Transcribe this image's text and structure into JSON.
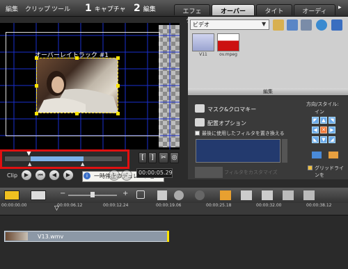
{
  "menu": [
    "編集",
    "クリップ",
    "ツール"
  ],
  "steps": [
    {
      "num": "1",
      "label": "キャプチャ"
    },
    {
      "num": "2",
      "label": "編集"
    }
  ],
  "tabs": [
    "エフェクト",
    "オーバーレイ",
    "タイトル",
    "オーディオ"
  ],
  "active_tab": "オーバーレイ",
  "preview": {
    "track_label": "オーバーレイトラック #1"
  },
  "playback": {
    "clip_label": "Clip",
    "timecode": "00:00:05.29",
    "tooltip": "一時停止のデュレーション"
  },
  "library": {
    "category": "ビデオ",
    "thumbnails": [
      {
        "name": "V11",
        "color": "#e8e8ff"
      },
      {
        "name": "ov.mpeg",
        "color": "#cc1111"
      }
    ]
  },
  "edit": {
    "header": "編集",
    "mask": "マスク&クロマキー",
    "placement": "配置オプション",
    "replace_checkbox": "最後に使用したフィルタを置き換える",
    "customize": "フィルタをカスタマイズ",
    "direction_title": "方向/スタイル:",
    "direction_in": "イン",
    "grid_checkbox": "グリッドラインを"
  },
  "timeline": {
    "ticks": [
      "00:00:00.00",
      "00:00:06.12",
      "00:00:12.24",
      "00:00:19.06",
      "00:00:25.18",
      "00:00:32.00",
      "00:00:38.12"
    ],
    "clip_name": "V13.wmv"
  },
  "colors": {
    "highlight": "#e01010",
    "grid": "#1a2fd0",
    "handle": "#ffe400",
    "scrub_fill": "#7cb0e8"
  }
}
